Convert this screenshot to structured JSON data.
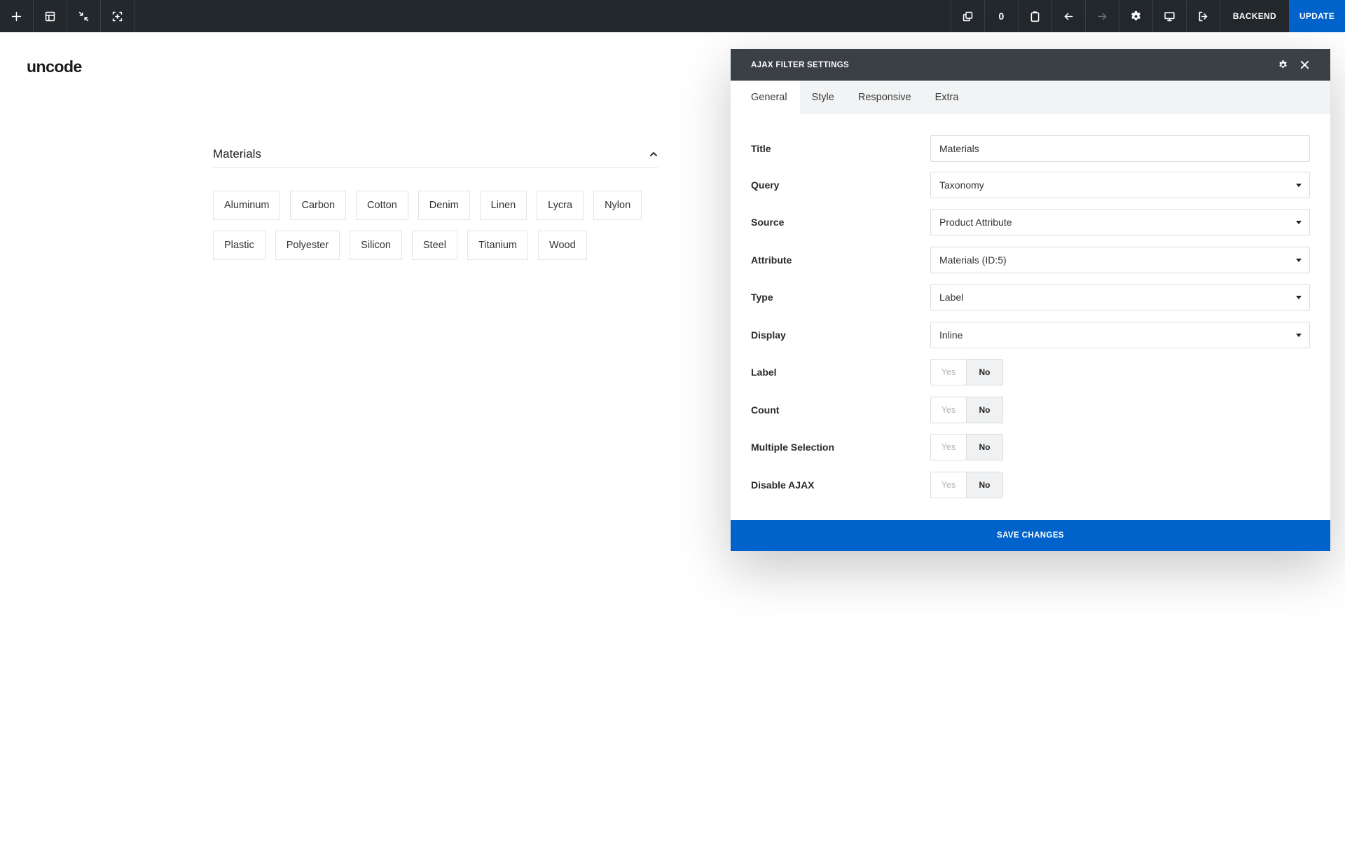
{
  "toolbar": {
    "left_icons": [
      "plus-icon",
      "layout-icon",
      "minimize-icon",
      "select-add-icon"
    ],
    "right_icons": [
      "duplicate-icon",
      "clipboard-icon",
      "undo-icon",
      "redo-icon",
      "gear-icon",
      "desktop-icon",
      "exit-icon"
    ],
    "clipboard_count": "0",
    "backend_label": "BACKEND",
    "update_label": "UPDATE",
    "accent_color": "#0063cb",
    "bar_color": "#23282d"
  },
  "page": {
    "logo": "uncode",
    "filter": {
      "title": "Materials",
      "chips": [
        "Aluminum",
        "Carbon",
        "Cotton",
        "Denim",
        "Linen",
        "Lycra",
        "Nylon",
        "Plastic",
        "Polyester",
        "Silicon",
        "Steel",
        "Titanium",
        "Wood"
      ]
    }
  },
  "modal": {
    "title": "AJAX FILTER SETTINGS",
    "header_icons": [
      "gear-icon",
      "close-icon"
    ],
    "tabs": [
      {
        "label": "General",
        "active": true
      },
      {
        "label": "Style",
        "active": false
      },
      {
        "label": "Responsive",
        "active": false
      },
      {
        "label": "Extra",
        "active": false
      }
    ],
    "fields": {
      "title": {
        "label": "Title",
        "value": "Materials"
      },
      "query": {
        "label": "Query",
        "value": "Taxonomy"
      },
      "source": {
        "label": "Source",
        "value": "Product Attribute"
      },
      "attribute": {
        "label": "Attribute",
        "value": "Materials (ID:5)"
      },
      "type": {
        "label": "Type",
        "value": "Label"
      },
      "display": {
        "label": "Display",
        "value": "Inline"
      }
    },
    "toggles": {
      "label": {
        "label": "Label",
        "yes": "Yes",
        "no": "No",
        "selected": "No"
      },
      "count": {
        "label": "Count",
        "yes": "Yes",
        "no": "No",
        "selected": "No"
      },
      "multiple": {
        "label": "Multiple Selection",
        "yes": "Yes",
        "no": "No",
        "selected": "No"
      },
      "disable_ajax": {
        "label": "Disable AJAX",
        "yes": "Yes",
        "no": "No",
        "selected": "No"
      }
    },
    "save_label": "SAVE CHANGES"
  }
}
